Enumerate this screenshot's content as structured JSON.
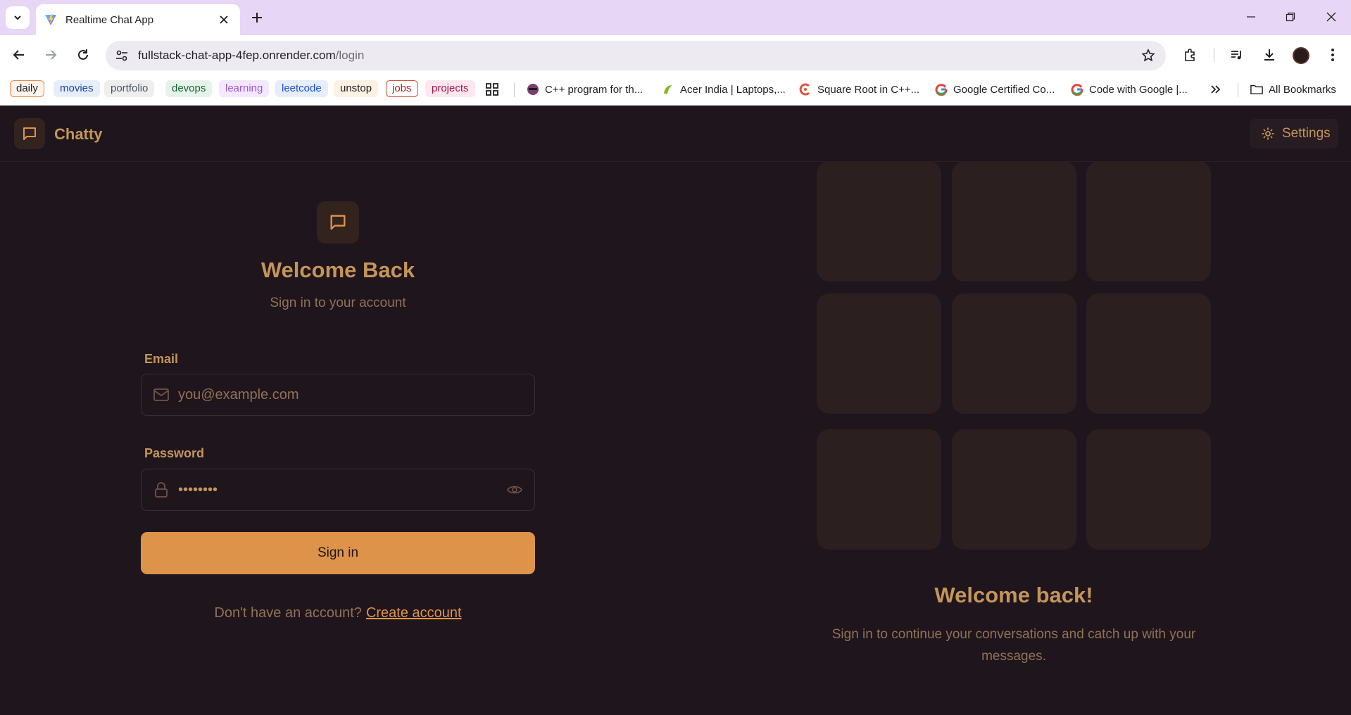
{
  "browser": {
    "tab_title": "Realtime Chat App",
    "url_host": "fullstack-chat-app-4fep.onrender.com",
    "url_path": "/login",
    "bookmark_chips": [
      {
        "label": "daily",
        "color": "#c2410c"
      },
      {
        "label": "movies",
        "color": "#1e40af"
      },
      {
        "label": "portfolio",
        "color": "#4b5563"
      },
      {
        "label": "devops",
        "color": "#166534"
      },
      {
        "label": "learning",
        "color": "#7e22ce"
      },
      {
        "label": "leetcode",
        "color": "#1d4ed8"
      },
      {
        "label": "unstop",
        "color": "#202124"
      },
      {
        "label": "jobs",
        "color": "#b91c1c"
      },
      {
        "label": "projects",
        "color": "#9d174d"
      }
    ],
    "bookmarks": [
      "C++ program for th...",
      "Acer India | Laptops,...",
      "Square Root in C++...",
      "Google Certified Co...",
      "Code with Google |..."
    ],
    "all_bookmarks": "All Bookmarks"
  },
  "app": {
    "brand": "Chatty",
    "settings_label": "Settings",
    "accent_color": "#dd934a"
  },
  "login": {
    "title": "Welcome Back",
    "subtitle": "Sign in to your account",
    "email_label": "Email",
    "email_placeholder": "you@example.com",
    "password_label": "Password",
    "password_value": "••••••••",
    "signin_label": "Sign in",
    "no_account_text": "Don't have an account?",
    "create_account_link": "Create account"
  },
  "hero": {
    "title": "Welcome back!",
    "subtitle": "Sign in to continue your conversations and catch up with your messages."
  }
}
